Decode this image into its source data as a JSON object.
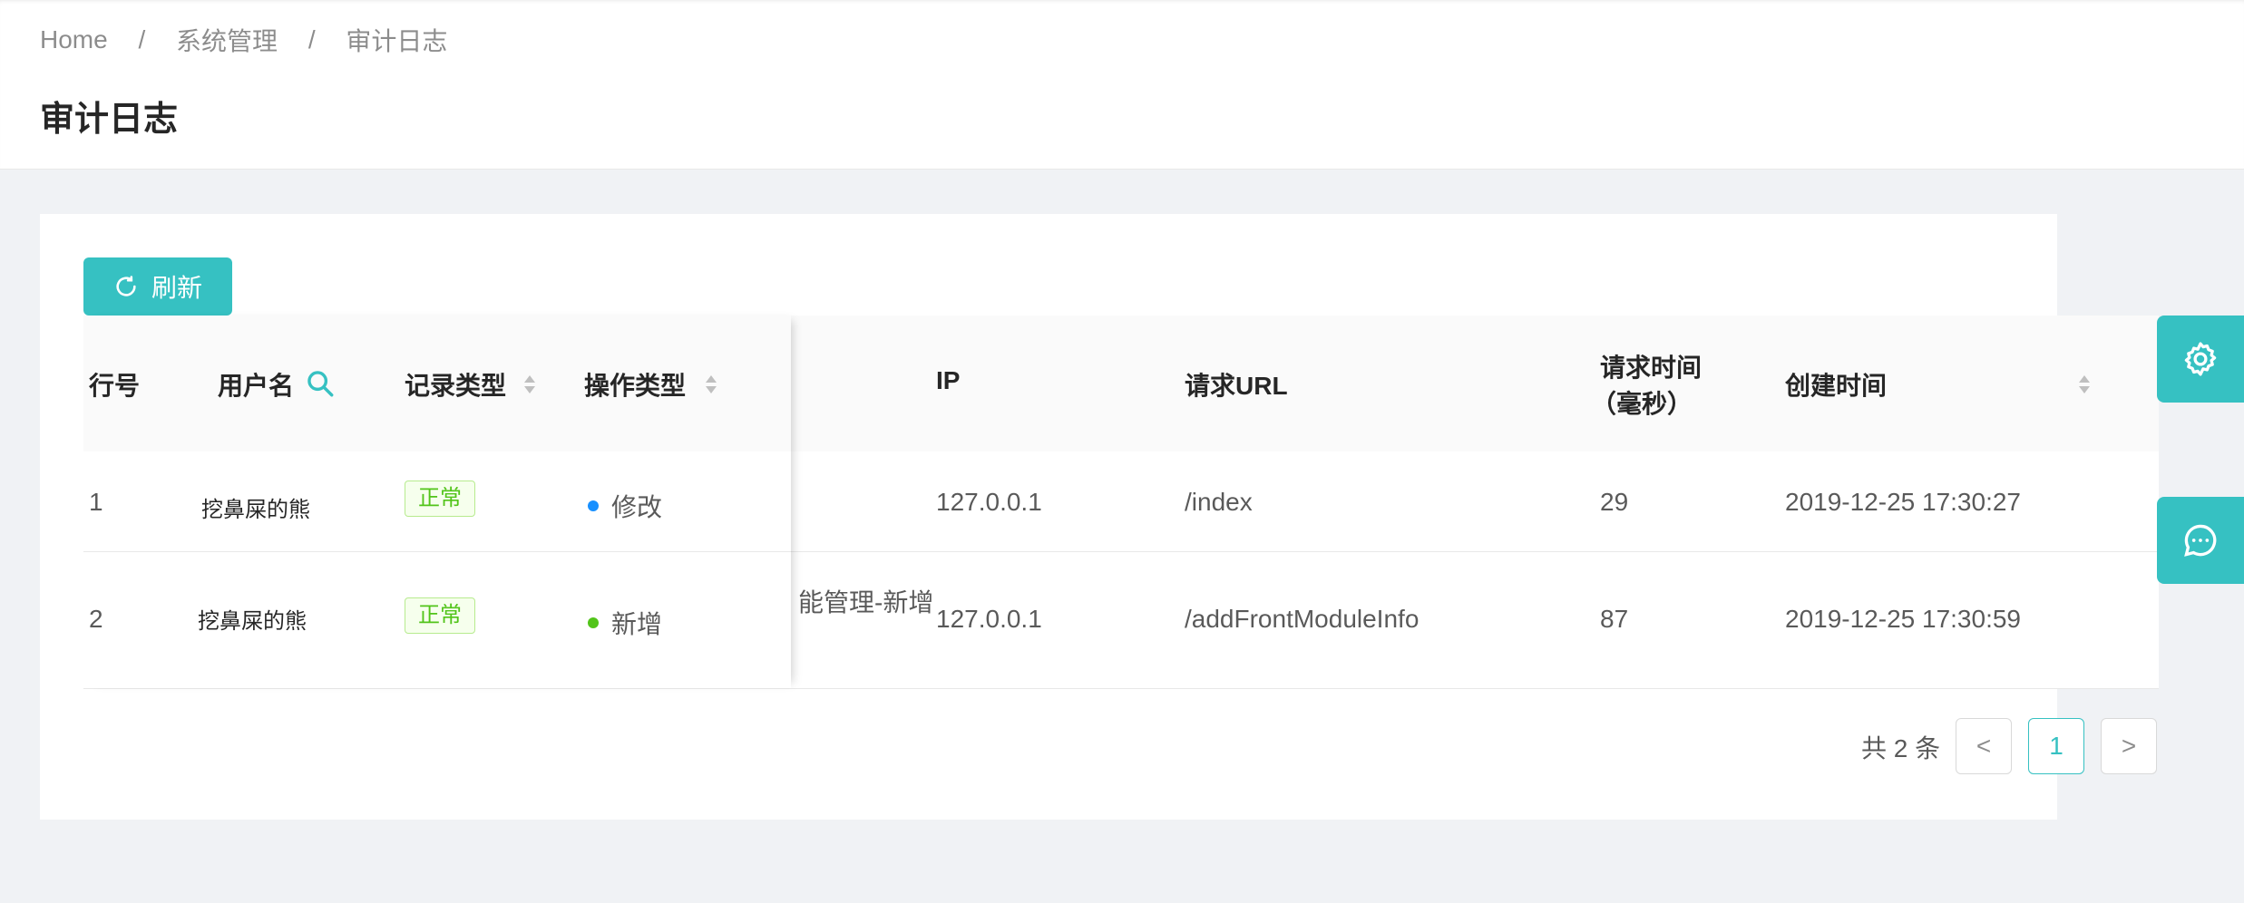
{
  "breadcrumb": {
    "home": "Home",
    "sep": "/",
    "level1": "系统管理",
    "level2": "审计日志"
  },
  "page_title": "审计日志",
  "toolbar": {
    "refresh_label": "刷新"
  },
  "table": {
    "headers": {
      "row_no": "行号",
      "username": "用户名",
      "record_type": "记录类型",
      "op_type": "操作类型",
      "ip": "IP",
      "url": "请求URL",
      "duration_line1": "请求时间",
      "duration_line2": "（毫秒）",
      "created": "创建时间"
    },
    "rows": [
      {
        "row_no": "1",
        "username": "挖鼻屎的熊",
        "record_type": "正常",
        "op_type": "修改",
        "op_color": "#1890ff",
        "desc": "",
        "ip": "127.0.0.1",
        "url": "/index",
        "duration": "29",
        "created": "2019-12-25 17:30:27"
      },
      {
        "row_no": "2",
        "username": "挖鼻屎的熊",
        "record_type": "正常",
        "op_type": "新增",
        "op_color": "#52c41a",
        "desc": "能管理-新增",
        "ip": "127.0.0.1",
        "url": "/addFrontModuleInfo",
        "duration": "87",
        "created": "2019-12-25 17:30:59"
      }
    ]
  },
  "pagination": {
    "total_text": "共 2 条",
    "prev": "<",
    "current": "1",
    "next": ">"
  },
  "icons": {
    "refresh": "reload-icon",
    "search": "search-icon",
    "settings": "gear-icon",
    "chat": "message-icon"
  },
  "colors": {
    "accent": "#36c1c2",
    "tag_green": "#52c41a",
    "dot_blue": "#1890ff"
  }
}
